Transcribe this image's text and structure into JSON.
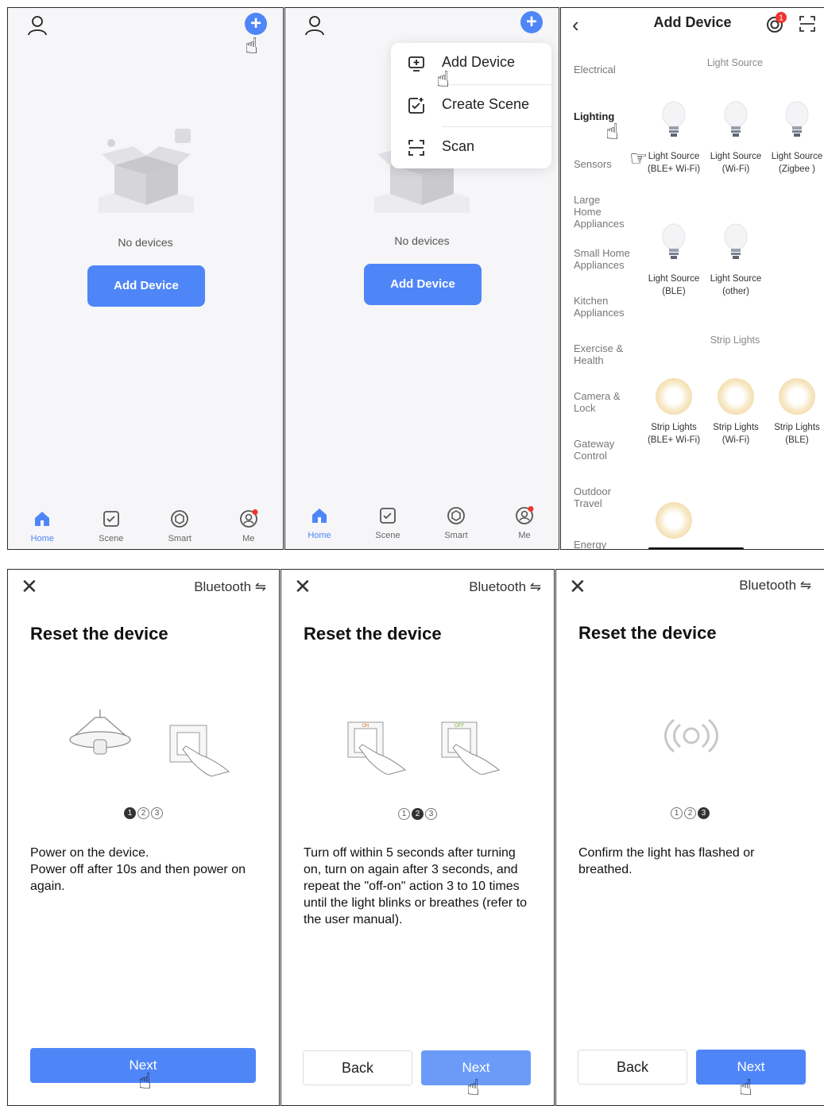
{
  "screen1": {
    "no_devices": "No devices",
    "add_device": "Add Device"
  },
  "screen2": {
    "no_devices": "No devices",
    "add_device": "Add Device",
    "menu": [
      "Add Device",
      "Create Scene",
      "Scan"
    ]
  },
  "tabs": [
    "Home",
    "Scene",
    "Smart",
    "Me"
  ],
  "add_screen": {
    "title": "Add Device",
    "badge": "1",
    "categories": [
      "Electrical",
      "Lighting",
      "Sensors",
      "Large Home Appliances",
      "Small Home Appliances",
      "Kitchen Appliances",
      "Exercise & Health",
      "Camera & Lock",
      "Gateway Control",
      "Outdoor Travel",
      "Energy"
    ],
    "section_light": "Light Source",
    "section_strip": "Strip Lights",
    "light_devices": [
      "Light Source (BLE+ Wi-Fi)",
      "Light Source (Wi-Fi)",
      "Light Source (Zigbee )",
      "Light Source (BLE)",
      "Light Source (other)"
    ],
    "strip_devices": [
      "Strip Lights (BLE+ Wi-Fi)",
      "Strip Lights (Wi-Fi)",
      "Strip Lights (BLE)"
    ]
  },
  "reset": {
    "bluetooth": "Bluetooth ⇋",
    "title": "Reset the device",
    "next": "Next",
    "back": "Back",
    "step1_text": "Power on the device.\nPower off after 10s and then power on again.",
    "step2_text": "Turn off within 5 seconds after turning on, turn on again after 3 seconds, and repeat the \"off-on\" action 3 to 10 times until the light blinks or breathes (refer to the user manual).",
    "step3_text": "Confirm the light has flashed or breathed.",
    "switch_on": "ON",
    "switch_off": "OFF"
  },
  "colors": {
    "accent": "#4f86f7",
    "badge": "#f0342f"
  }
}
